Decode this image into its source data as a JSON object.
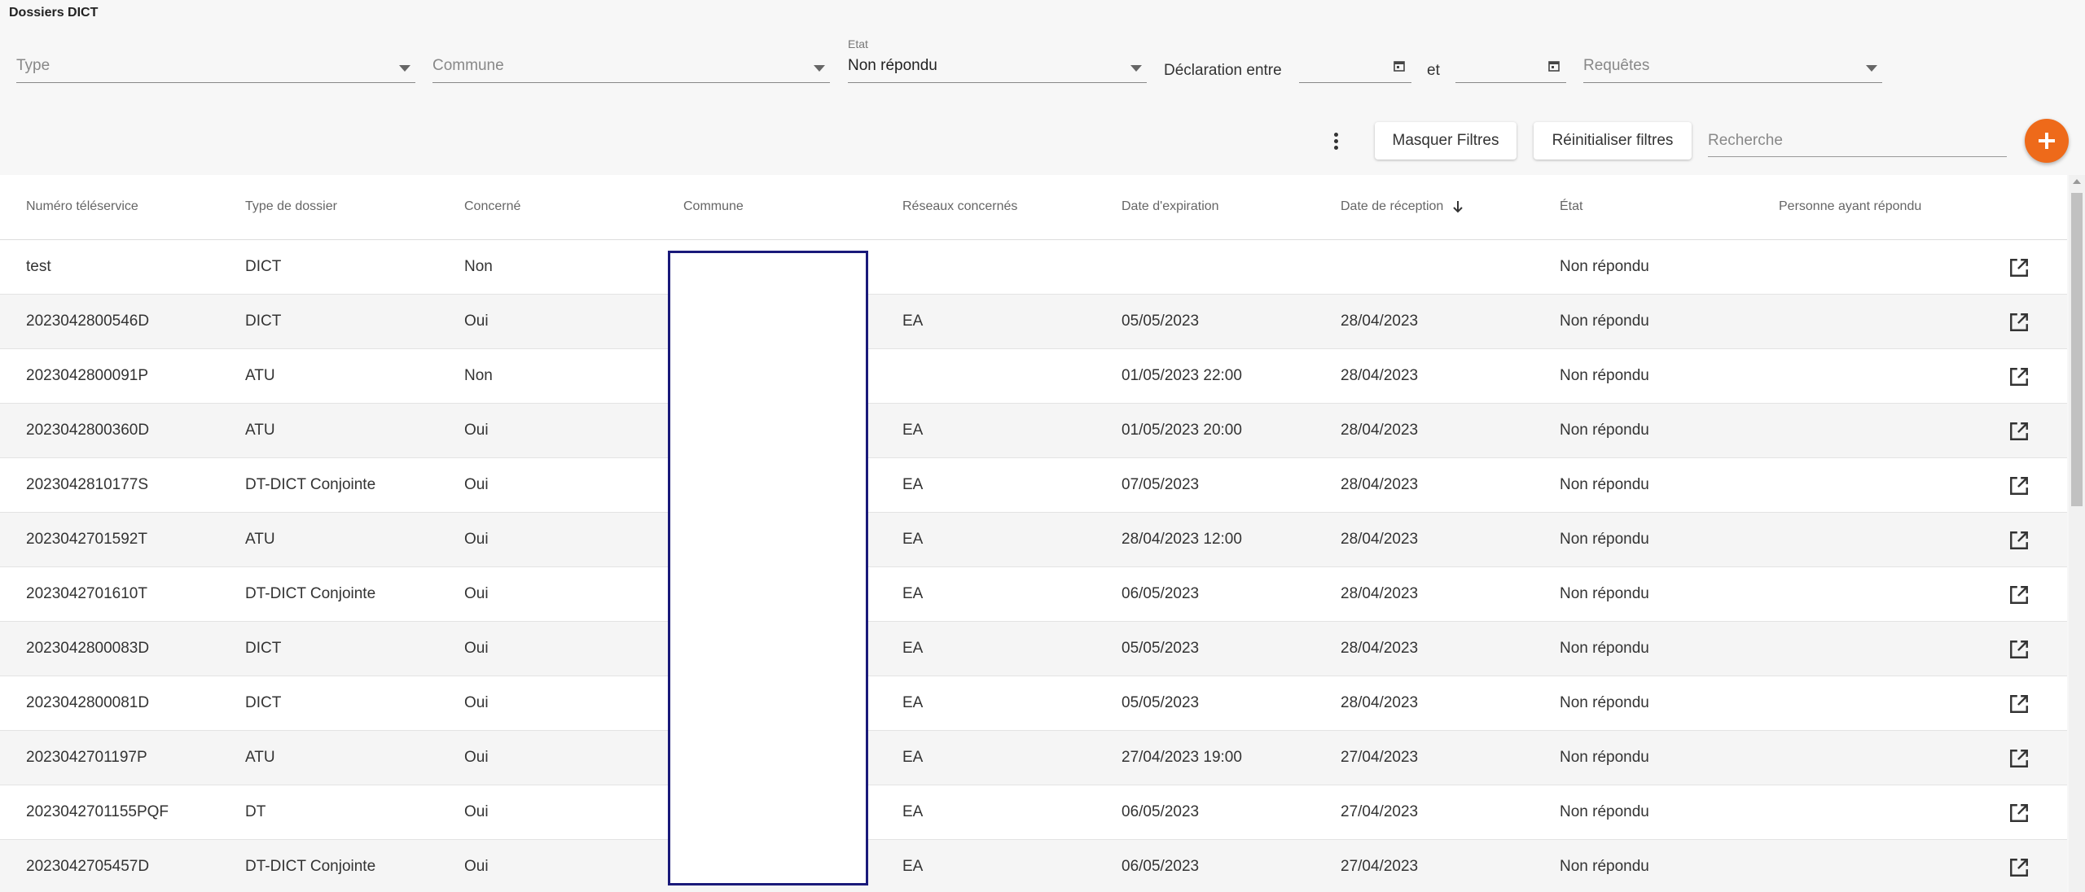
{
  "page_title": "Dossiers DICT",
  "filters": {
    "type": {
      "placeholder": "Type",
      "value": ""
    },
    "commune": {
      "placeholder": "Commune",
      "value": ""
    },
    "etat": {
      "label": "Etat",
      "value": "Non répondu"
    },
    "declaration_label": "Déclaration entre",
    "date_from": "",
    "et_label": "et",
    "date_to": "",
    "requetes": {
      "placeholder": "Requêtes",
      "value": ""
    }
  },
  "toolbar": {
    "hide_filters_label": "Masquer Filtres",
    "reset_filters_label": "Réinitialiser filtres",
    "search_placeholder": "Recherche"
  },
  "table": {
    "columns": [
      "Numéro téléservice",
      "Type de dossier",
      "Concerné",
      "Commune",
      "Réseaux concernés",
      "Date d'expiration",
      "Date de réception",
      "État",
      "Personne ayant répondu"
    ],
    "sorted_column": "Date de réception",
    "sort_direction": "descending",
    "rows": [
      [
        "test",
        "DICT",
        "Non",
        "",
        "",
        "",
        "",
        "Non répondu",
        ""
      ],
      [
        "2023042800546D",
        "DICT",
        "Oui",
        "",
        "EA",
        "05/05/2023",
        "28/04/2023",
        "Non répondu",
        ""
      ],
      [
        "2023042800091P",
        "ATU",
        "Non",
        "",
        "",
        "01/05/2023 22:00",
        "28/04/2023",
        "Non répondu",
        ""
      ],
      [
        "2023042800360D",
        "ATU",
        "Oui",
        "",
        "EA",
        "01/05/2023 20:00",
        "28/04/2023",
        "Non répondu",
        ""
      ],
      [
        "2023042810177S",
        "DT-DICT Conjointe",
        "Oui",
        "",
        "EA",
        "07/05/2023",
        "28/04/2023",
        "Non répondu",
        ""
      ],
      [
        "2023042701592T",
        "ATU",
        "Oui",
        "",
        "EA",
        "28/04/2023 12:00",
        "28/04/2023",
        "Non répondu",
        ""
      ],
      [
        "2023042701610T",
        "DT-DICT Conjointe",
        "Oui",
        "",
        "EA",
        "06/05/2023",
        "28/04/2023",
        "Non répondu",
        ""
      ],
      [
        "2023042800083D",
        "DICT",
        "Oui",
        "",
        "EA",
        "05/05/2023",
        "28/04/2023",
        "Non répondu",
        ""
      ],
      [
        "2023042800081D",
        "DICT",
        "Oui",
        "",
        "EA",
        "05/05/2023",
        "28/04/2023",
        "Non répondu",
        ""
      ],
      [
        "2023042701197P",
        "ATU",
        "Oui",
        "",
        "EA",
        "27/04/2023 19:00",
        "27/04/2023",
        "Non répondu",
        ""
      ],
      [
        "2023042701155PQF",
        "DT",
        "Oui",
        "",
        "EA",
        "06/05/2023",
        "27/04/2023",
        "Non répondu",
        ""
      ],
      [
        "2023042705457D",
        "DT-DICT Conjointe",
        "Oui",
        "",
        "EA",
        "06/05/2023",
        "27/04/2023",
        "Non répondu",
        ""
      ]
    ]
  },
  "icons": {
    "add": "plus-icon",
    "more": "kebab-menu-icon",
    "calendar": "calendar-icon",
    "open": "open-in-new-icon",
    "sort": "arrow-down-icon"
  },
  "colors": {
    "accent": "#ee6a1a",
    "redaction_border": "#1a1a7a"
  }
}
